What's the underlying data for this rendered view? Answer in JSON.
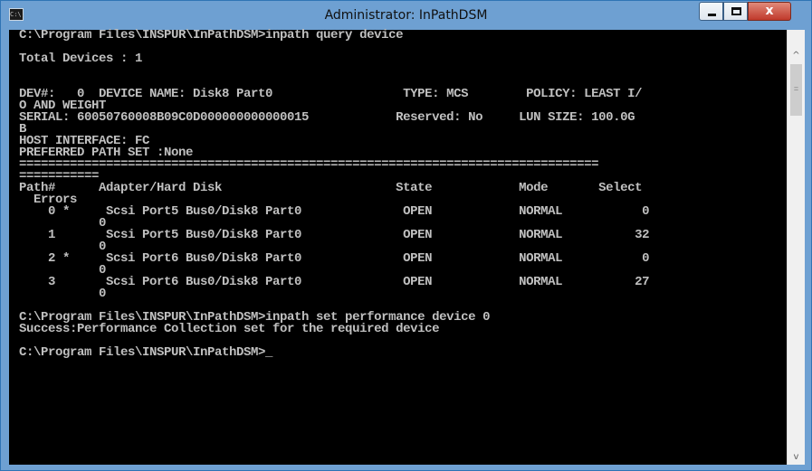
{
  "window": {
    "title": "Administrator: InPathDSM",
    "icon_label": "C:\\.",
    "icon": "console-app-icon"
  },
  "controls": {
    "minimize_icon": "minimize-icon",
    "maximize_icon": "maximize-icon",
    "close_label": "x"
  },
  "scrollbar": {
    "up_arrow": "^",
    "down_arrow": "v",
    "grip": "="
  },
  "console": {
    "lines": [
      "C:\\Program Files\\INSPUR\\InPathDSM>inpath query device",
      "",
      "Total Devices : 1",
      "",
      "",
      "DEV#:   0  DEVICE NAME: Disk8 Part0                  TYPE: MCS        POLICY: LEAST I/",
      "O AND WEIGHT",
      "SERIAL: 60050760008B09C0D000000000000015            Reserved: No     LUN SIZE: 100.0G",
      "B",
      "HOST INTERFACE: FC",
      "PREFERRED PATH SET :None",
      "================================================================================",
      "===========",
      "Path#      Adapter/Hard Disk                        State            Mode       Select",
      "  Errors",
      "    0 *     Scsi Port5 Bus0/Disk8 Part0              OPEN            NORMAL           0",
      "           0",
      "    1       Scsi Port5 Bus0/Disk8 Part0              OPEN            NORMAL          32",
      "           0",
      "    2 *     Scsi Port6 Bus0/Disk8 Part0              OPEN            NORMAL           0",
      "           0",
      "    3       Scsi Port6 Bus0/Disk8 Part0              OPEN            NORMAL          27",
      "           0",
      "",
      "C:\\Program Files\\INSPUR\\InPathDSM>inpath set performance device 0",
      "Success:Performance Collection set for the required device",
      "",
      "C:\\Program Files\\INSPUR\\InPathDSM>_"
    ]
  }
}
